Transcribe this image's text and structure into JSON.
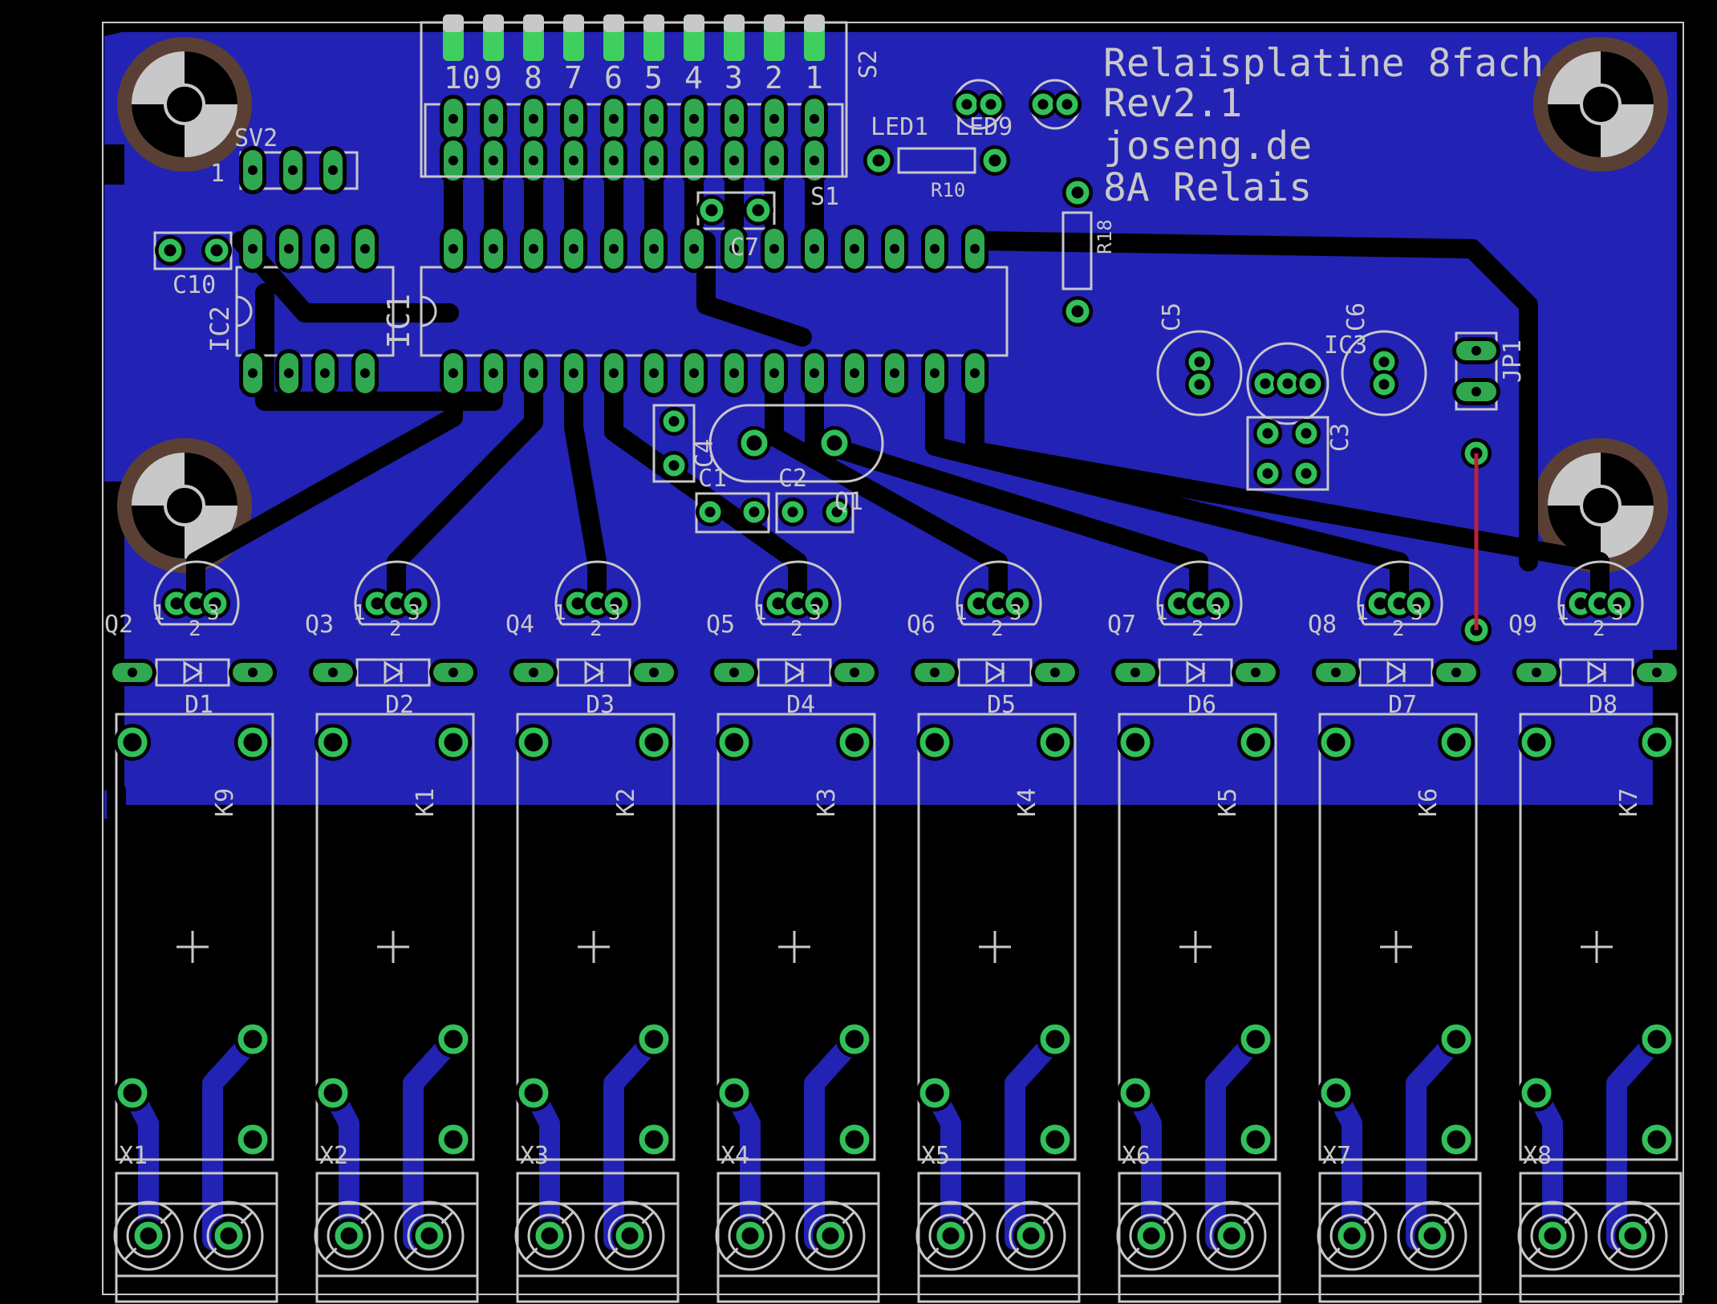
{
  "board_text": [
    "Relaisplatine 8fach",
    "Rev2.1",
    "joseng.de",
    "8A Relais"
  ],
  "switch": {
    "name": "S2",
    "name_bottom": "S1",
    "numbers": [
      "10",
      "9",
      "8",
      "7",
      "6",
      "5",
      "4",
      "3",
      "2",
      "1"
    ]
  },
  "header_sv2": {
    "name": "SV2",
    "pin1": "1"
  },
  "ics": {
    "ic1": "IC1",
    "ic2": "IC2",
    "ic3": "IC3"
  },
  "caps": {
    "c1": "C1",
    "c2": "C2",
    "c3": "C3",
    "c4": "C4",
    "c5": "C5",
    "c6": "C6",
    "c7": "C7",
    "c10": "C10"
  },
  "resistors": {
    "r10": "R10",
    "r18": "R18"
  },
  "leds": {
    "led1": "LED1",
    "led9": "LED9"
  },
  "jumper": "JP1",
  "crystal": "Q1",
  "pin_numbers": [
    "1",
    "2",
    "3"
  ],
  "channels": [
    {
      "transistor": "Q2",
      "diode": "D1",
      "relay": "K9",
      "terminal": "X1"
    },
    {
      "transistor": "Q3",
      "diode": "D2",
      "relay": "K1",
      "terminal": "X2"
    },
    {
      "transistor": "Q4",
      "diode": "D3",
      "relay": "K2",
      "terminal": "X3"
    },
    {
      "transistor": "Q5",
      "diode": "D4",
      "relay": "K3",
      "terminal": "X4"
    },
    {
      "transistor": "Q6",
      "diode": "D5",
      "relay": "K4",
      "terminal": "X5"
    },
    {
      "transistor": "Q7",
      "diode": "D6",
      "relay": "K5",
      "terminal": "X6"
    },
    {
      "transistor": "Q8",
      "diode": "D7",
      "relay": "K6",
      "terminal": "X7"
    },
    {
      "transistor": "Q9",
      "diode": "D8",
      "relay": "K7",
      "terminal": "X8"
    }
  ],
  "colors": {
    "background": "#000000",
    "copper_pour": "#2222b4",
    "track": "#000000",
    "silkscreen": "#c8c8c8",
    "pad": "#2fa84f",
    "via_ring": "#31c05a",
    "airwire": "#c0203a",
    "mounting_hole": "#5a4034"
  }
}
